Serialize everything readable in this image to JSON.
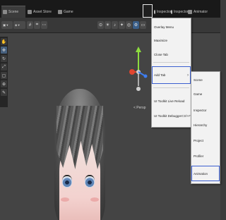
{
  "tabs": [
    {
      "label": "Scene",
      "icon": "scene-icon",
      "active": true
    },
    {
      "label": "Asset Store",
      "icon": "asset-store-icon",
      "active": false
    },
    {
      "label": "Game",
      "icon": "game-icon",
      "active": false
    },
    {
      "label": "Inspector",
      "icon": "inspector-icon",
      "active": false
    },
    {
      "label": "Inspector",
      "icon": "inspector-icon",
      "active": false
    },
    {
      "label": "Animator",
      "icon": "animator-icon",
      "active": false
    }
  ],
  "toolbar": {
    "shading_label": "",
    "mode_label": ""
  },
  "gizmo": {
    "axes": [
      {
        "label": "y",
        "color": "#8ddc3e"
      },
      {
        "label": "x",
        "color": "#e0452f"
      },
      {
        "label": "z",
        "color": "#3d7df0"
      }
    ],
    "projection_label": "< Persp"
  },
  "context_menu": {
    "items": [
      {
        "label": "Overlay Menu",
        "shortcut": ""
      },
      {
        "label": "Maximize",
        "shortcut": ""
      },
      {
        "label": "Close Tab",
        "shortcut": ""
      },
      {
        "label": "Add Tab",
        "shortcut": "",
        "submenu": true,
        "highlighted": true
      },
      {
        "label": "UI Toolkit Live Reload",
        "shortcut": ""
      },
      {
        "label": "UI Toolkit Debugger",
        "shortcut": "Ctrl+F5"
      }
    ]
  },
  "submenu": {
    "items": [
      {
        "label": "Scene",
        "highlighted": false
      },
      {
        "label": "Game",
        "highlighted": false
      },
      {
        "label": "Inspector",
        "highlighted": false
      },
      {
        "label": "Hierarchy",
        "highlighted": false
      },
      {
        "label": "Project",
        "highlighted": false
      },
      {
        "label": "Profiler",
        "highlighted": false
      },
      {
        "label": "Animation",
        "highlighted": true
      }
    ]
  },
  "colors": {
    "menu_highlight": "#3b5fd0",
    "viewport_bg": "#444444",
    "tabstrip_bg": "#191919"
  }
}
